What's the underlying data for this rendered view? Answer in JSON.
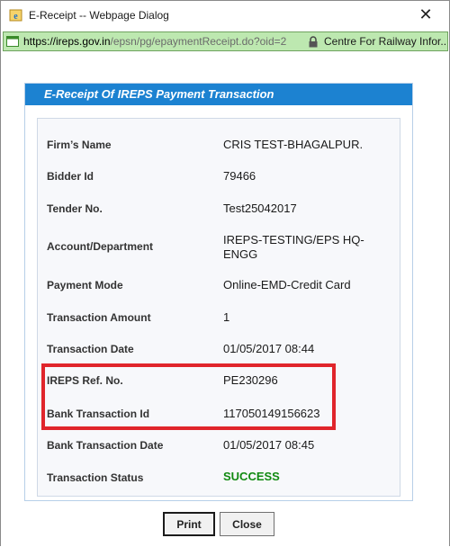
{
  "window": {
    "title": "E-Receipt -- Webpage Dialog",
    "close_glyph": "✕"
  },
  "address_bar": {
    "url_host": "https://ireps.gov.in",
    "url_path": "/epsn/pg/epaymentReceipt.do?oid=2",
    "identity": "Centre For Railway Infor..."
  },
  "receipt": {
    "title": "E-Receipt Of IREPS Payment Transaction",
    "rows": [
      {
        "label": "Firm’s Name",
        "value": "CRIS TEST-BHAGALPUR."
      },
      {
        "label": "Bidder Id",
        "value": "79466"
      },
      {
        "label": "Tender No.",
        "value": "Test25042017"
      },
      {
        "label": "Account/Department",
        "value": "IREPS-TESTING/EPS HQ-ENGG"
      },
      {
        "label": "Payment Mode",
        "value": "Online-EMD-Credit Card"
      },
      {
        "label": "Transaction Amount",
        "value": "1"
      },
      {
        "label": "Transaction Date",
        "value": "01/05/2017 08:44"
      },
      {
        "label": "IREPS Ref. No.",
        "value": "PE230296"
      },
      {
        "label": "Bank Transaction Id",
        "value": "117050149156623"
      },
      {
        "label": "Bank Transaction Date",
        "value": "01/05/2017 08:45"
      },
      {
        "label": "Transaction Status",
        "value": "SUCCESS"
      }
    ]
  },
  "buttons": {
    "print": "Print",
    "close": "Close"
  },
  "colors": {
    "header_blue": "#1c82d1",
    "address_green": "#bde8b0",
    "success_green": "#118a11",
    "highlight_red": "#e0252b"
  }
}
